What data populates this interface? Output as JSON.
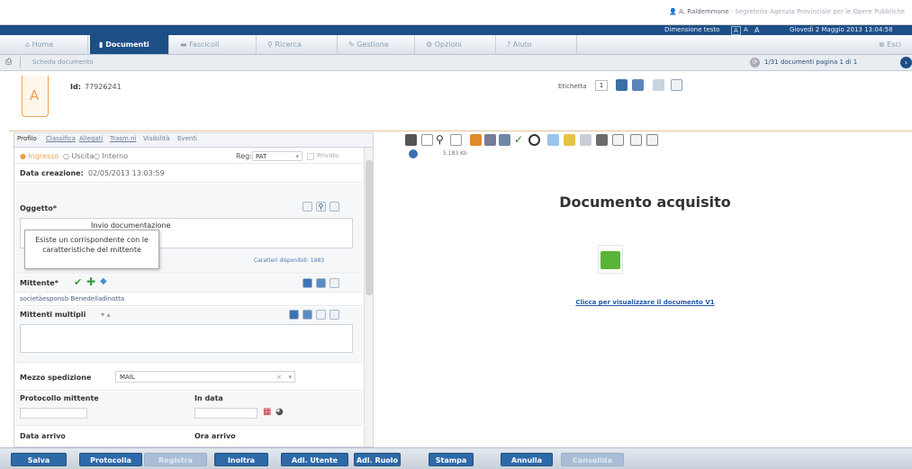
{
  "header": {
    "user_name": "A. Raldemmone",
    "office": "Segreteria Agenzia Provinciale per le Opere Pubbliche",
    "text_size_label": "Dimensione testo",
    "text_size_options": [
      "A",
      "A",
      "A"
    ],
    "date": "Giovedì 2 Maggio 2013 13:04:58"
  },
  "nav": {
    "tabs": [
      "Home",
      "Documenti",
      "Fascicoli",
      "Ricerca",
      "Gestione",
      "Opzioni",
      "Aiuto"
    ],
    "exit": "Esci"
  },
  "subbar": {
    "breadcrumb": "Scheda documento",
    "pager": "1/31 documenti pagina 1 di 1"
  },
  "document": {
    "type_letter": "A",
    "id_label": "Id:",
    "id_value": "77926241",
    "label_caption": "Etichetta",
    "label_value": "1"
  },
  "form": {
    "tabs": [
      "Profilo",
      "Classifica",
      "Allegati",
      "Trasm.ni",
      "Visibilità",
      "Eventi"
    ],
    "direction": {
      "options": [
        "Ingresso",
        "Uscita",
        "Interno"
      ],
      "selected": "Ingresso"
    },
    "reg_label": "Reg:",
    "reg_value": "PAT",
    "privato_label": "Privato",
    "created_label": "Data creazione:",
    "created_value": "02/05/2013 13:03:59",
    "oggetto_label": "Oggetto*",
    "oggetto_value": "Invio documentazione",
    "char_counter": "Caratteri disponibili: 1983",
    "tooltip": "Esiste un corrispondente con le caratteristiche del mittente",
    "mittente_label": "Mittente*",
    "mittente_value": "societàesponsb Benedelladinotta",
    "mittenti_multipli_label": "Mittenti multipli",
    "mezzo_label": "Mezzo spedizione",
    "mezzo_value": "MAIL",
    "protocollo_mittente_label": "Protocollo mittente",
    "in_data_label": "In data",
    "data_arrivo_label": "Data arrivo",
    "ora_arrivo_label": "Ora arrivo"
  },
  "viewer": {
    "file_size": "5.183 Kb",
    "title": "Documento acquisito",
    "link": "Clicca per visualizzare il documento V1"
  },
  "buttons": [
    "Salva",
    "Protocolla",
    "Inoltra",
    "Adl. Utente",
    "Adl. Ruolo",
    "Stampa",
    "Annulla"
  ],
  "disabled_buttons": [
    "Registra",
    "Consolida"
  ],
  "colors": {
    "primary": "#1d4f87",
    "button": "#2e6aa8",
    "accent": "#f0a050",
    "link": "#2259a8"
  }
}
